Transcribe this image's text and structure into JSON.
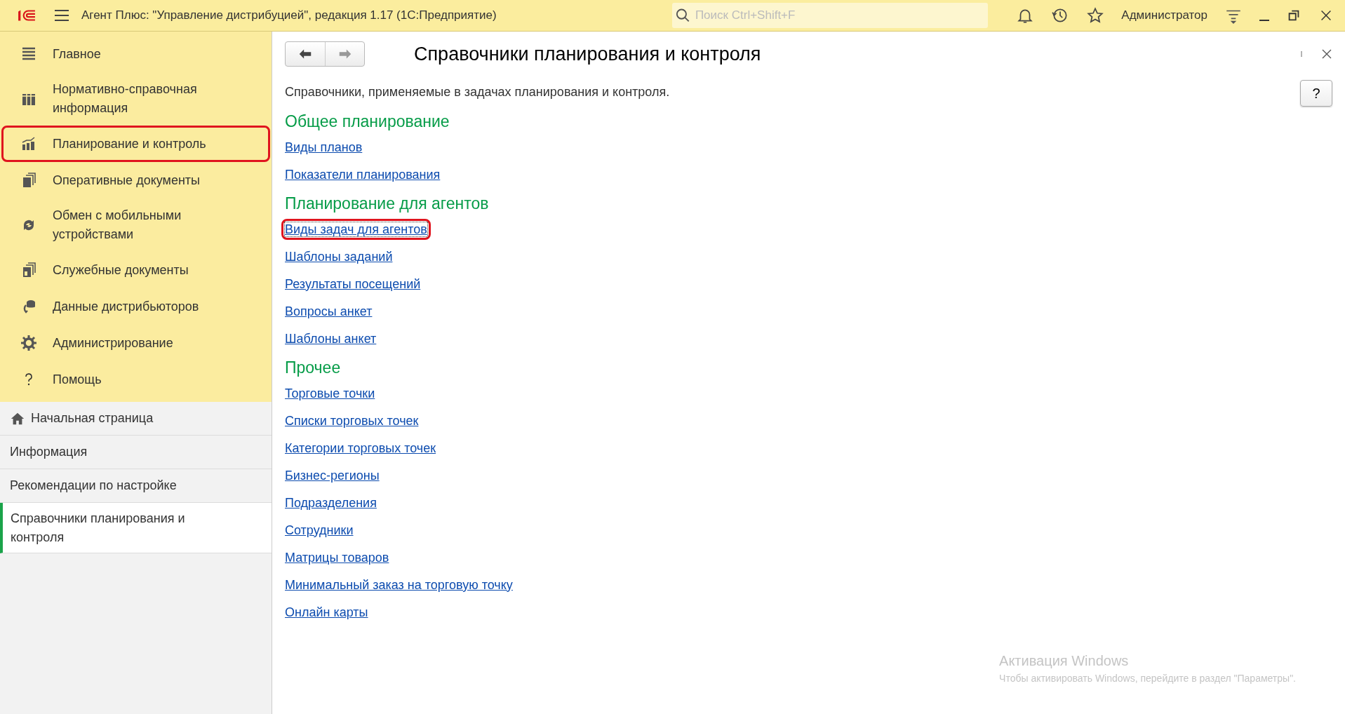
{
  "window": {
    "title": "Агент Плюс: \"Управление дистрибуцией\", редакция 1.17  (1С:Предприятие)",
    "search": {
      "placeholder": "Поиск Ctrl+Shift+F"
    },
    "user": "Администратор"
  },
  "sections": [
    {
      "kind": "lines",
      "label": "Главное",
      "highlighted": false
    },
    {
      "kind": "grid",
      "label": "Нормативно-справочная информация",
      "highlighted": false
    },
    {
      "kind": "chart",
      "label": "Планирование и контроль",
      "highlighted": true
    },
    {
      "kind": "docs",
      "label": "Оперативные документы",
      "highlighted": false
    },
    {
      "kind": "sync",
      "label": "Обмен с мобильными устройствами",
      "highlighted": false
    },
    {
      "kind": "service",
      "label": "Служебные документы",
      "highlighted": false
    },
    {
      "kind": "data",
      "label": "Данные дистрибьюторов",
      "highlighted": false
    },
    {
      "kind": "gear",
      "label": "Администрирование",
      "highlighted": false
    },
    {
      "kind": "help",
      "label": "Помощь",
      "highlighted": false
    }
  ],
  "open_pages": [
    {
      "label": "Начальная страница",
      "home": true,
      "selected": false
    },
    {
      "label": "Информация",
      "home": false,
      "selected": false
    },
    {
      "label": "Рекомендации по настройке",
      "home": false,
      "selected": false
    },
    {
      "label": "Справочники планирования и контроля",
      "home": false,
      "selected": true
    }
  ],
  "form": {
    "title": "Справочники планирования и контроля",
    "help_button": "?",
    "description": "Справочники, применяемые в задачах планирования и контроля.",
    "groups": [
      {
        "heading": "Общее планирование",
        "links": [
          {
            "label": "Виды планов",
            "highlighted": false
          },
          {
            "label": "Показатели планирования",
            "highlighted": false
          }
        ]
      },
      {
        "heading": "Планирование для агентов",
        "links": [
          {
            "label": "Виды задач для агентов",
            "highlighted": true
          },
          {
            "label": "Шаблоны заданий",
            "highlighted": false
          },
          {
            "label": "Результаты посещений",
            "highlighted": false
          },
          {
            "label": "Вопросы анкет",
            "highlighted": false
          },
          {
            "label": "Шаблоны анкет",
            "highlighted": false
          }
        ]
      },
      {
        "heading": "Прочее",
        "links": [
          {
            "label": "Торговые точки",
            "highlighted": false
          },
          {
            "label": "Списки торговых точек",
            "highlighted": false
          },
          {
            "label": "Категории торговых точек",
            "highlighted": false
          },
          {
            "label": "Бизнес-регионы",
            "highlighted": false
          },
          {
            "label": "Подразделения",
            "highlighted": false
          },
          {
            "label": "Сотрудники",
            "highlighted": false
          },
          {
            "label": "Матрицы товаров",
            "highlighted": false
          },
          {
            "label": "Минимальный заказ на торговую точку",
            "highlighted": false
          },
          {
            "label": "Онлайн карты",
            "highlighted": false
          }
        ]
      }
    ]
  },
  "os_notice": {
    "title": "Активация Windows",
    "text": "Чтобы активировать Windows, перейдите в раздел \"Параметры\"."
  }
}
